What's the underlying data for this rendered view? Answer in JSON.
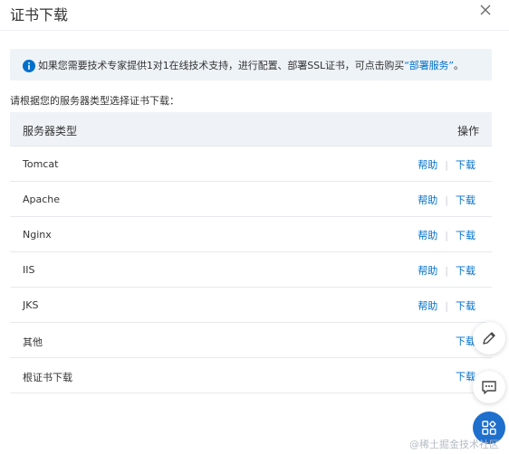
{
  "dialog": {
    "title": "证书下载",
    "close_icon": "close-icon"
  },
  "notice": {
    "icon": "info-icon",
    "text": "如果您需要技术专家提供1对1在线技术支持，进行配置、部署SSL证书，可点击购买",
    "link": "“部署服务”",
    "suffix": "。"
  },
  "prompt": "请根据您的服务器类型选择证书下载：",
  "table": {
    "headers": {
      "type": "服务器类型",
      "action": "操作"
    },
    "help_label": "帮助",
    "separator": "|",
    "download_label": "下载",
    "rows": [
      {
        "name": "Tomcat",
        "help": "帮助",
        "download": "下载"
      },
      {
        "name": "Apache",
        "help": "帮助",
        "download": "下载"
      },
      {
        "name": "Nginx",
        "help": "帮助",
        "download": "下载"
      },
      {
        "name": "IIS",
        "help": "帮助",
        "download": "下载"
      },
      {
        "name": "JKS",
        "help": "帮助",
        "download": "下载"
      },
      {
        "name": "其他",
        "download": "下载"
      },
      {
        "name": "根证书下载",
        "download": "下载"
      }
    ]
  },
  "floating_buttons": [
    "edit-icon",
    "chat-icon",
    "apps-icon"
  ],
  "watermark": "@稀土掘金技术社区",
  "colors": {
    "link": "#0070cc",
    "notice_bg": "#eef3f8",
    "header_bg": "#eff3f7",
    "fab_primary": "#1f6fcd"
  }
}
